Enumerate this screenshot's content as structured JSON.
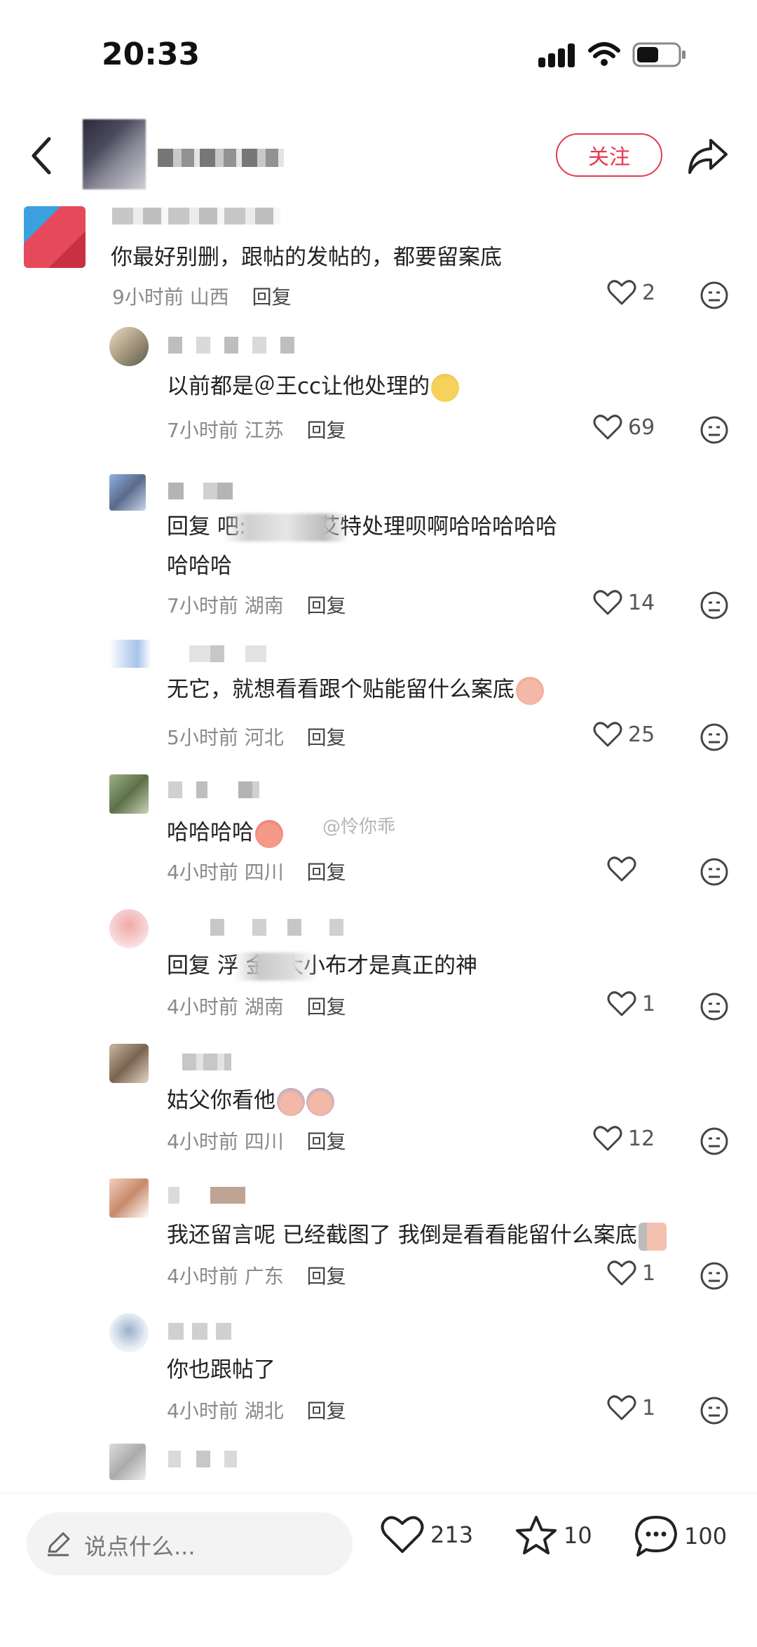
{
  "status": {
    "time": "20:33"
  },
  "header": {
    "follow_label": "关注"
  },
  "watermark": "@怜你乖",
  "comments": [
    {
      "text": "你最好别删，跟帖的发帖的，都要留案底",
      "time": "9小时前",
      "region": "山西",
      "reply": "回复",
      "likes": "2"
    },
    {
      "text": "以前都是＠王cc让他处理的",
      "time": "7小时前",
      "region": "江苏",
      "reply": "回复",
      "likes": "69"
    },
    {
      "text_line1": "回复                  吧: 这次也艾特处理呗啊哈哈哈哈哈",
      "text_line2": "哈哈哈",
      "time": "7小时前",
      "region": "湖南",
      "reply": "回复",
      "likes": "14"
    },
    {
      "text": "无它，就想看看跟个贴能留什么案底",
      "time": "5小时前",
      "region": "河北",
      "reply": "回复",
      "likes": "25"
    },
    {
      "text": "哈哈哈哈",
      "time": "4小时前",
      "region": "四川",
      "reply": "回复",
      "likes": ""
    },
    {
      "text": "回复 浮         金: 大小布才是真正的神",
      "time": "4小时前",
      "region": "湖南",
      "reply": "回复",
      "likes": "1"
    },
    {
      "text": "姑父你看他",
      "time": "4小时前",
      "region": "四川",
      "reply": "回复",
      "likes": "12"
    },
    {
      "text": "我还留言呢 已经截图了 我倒是看看能留什么案底",
      "time": "4小时前",
      "region": "广东",
      "reply": "回复",
      "likes": "1"
    },
    {
      "text": "你也跟帖了",
      "time": "4小时前",
      "region": "湖北",
      "reply": "回复",
      "likes": "1"
    }
  ],
  "bottom": {
    "placeholder": "说点什么...",
    "likes": "213",
    "stars": "10",
    "comments": "100"
  }
}
